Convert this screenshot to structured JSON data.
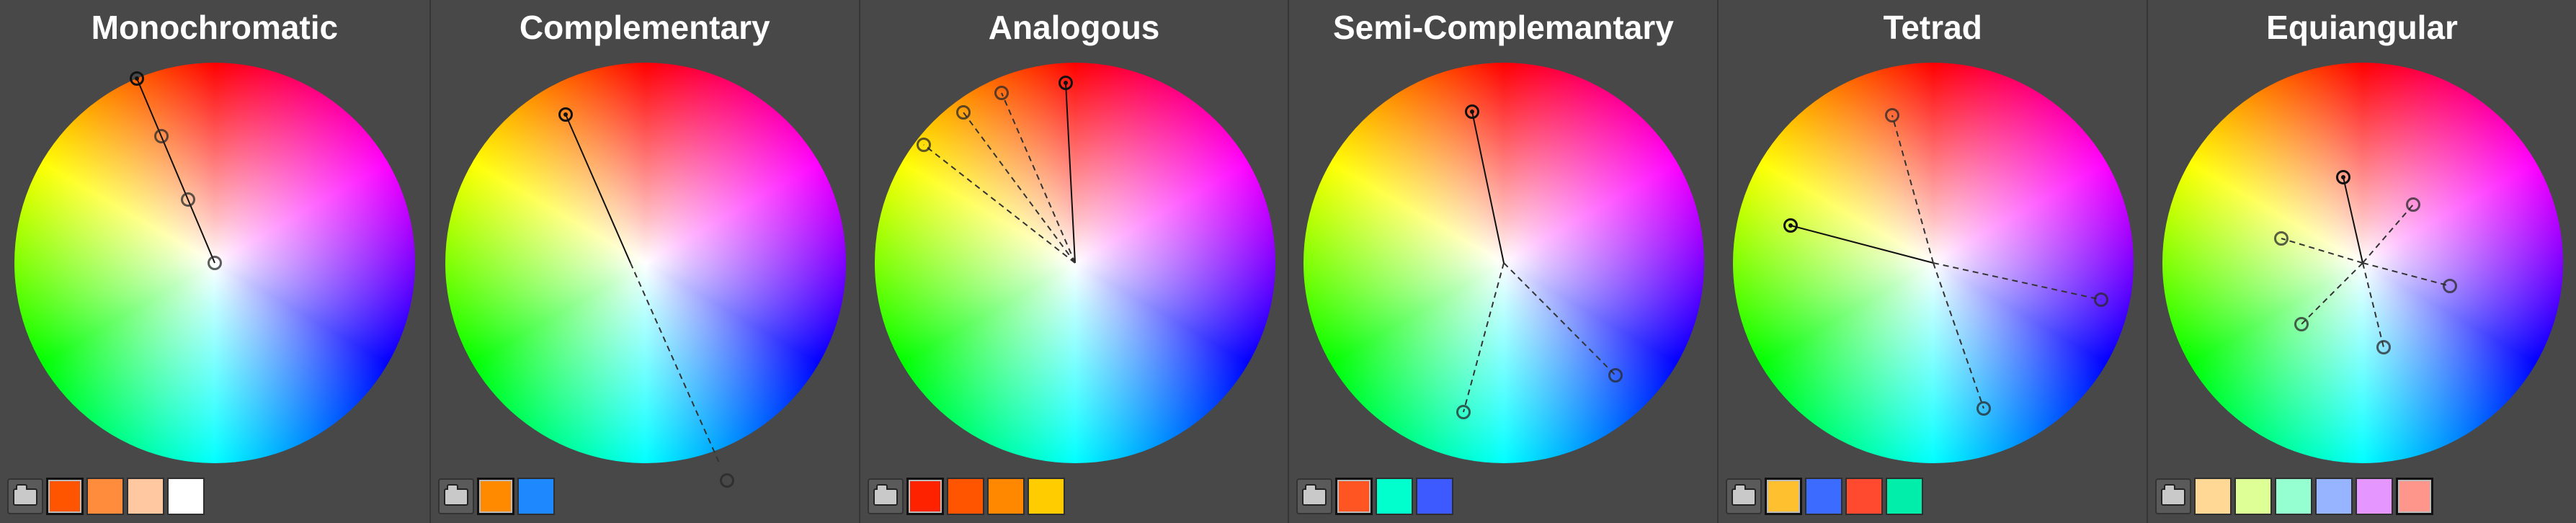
{
  "panels": [
    {
      "title": "Monochromatic",
      "center": [
        298,
        278
      ],
      "handles": [
        [
          190,
          22
        ],
        [
          224,
          102
        ],
        [
          261,
          190
        ],
        [
          298,
          278
        ]
      ],
      "primary_index": 0,
      "solid_lines": [
        [
          0,
          3
        ]
      ],
      "dashed_lines": [],
      "swatches": [
        "#ff5500",
        "#ff8c3c",
        "#ffc8a0",
        "#ffffff"
      ],
      "selected_swatch": 0
    },
    {
      "title": "Complementary",
      "center": [
        277,
        278
      ],
      "handles": [
        [
          187,
          72
        ],
        [
          411,
          580
        ]
      ],
      "primary_index": 0,
      "solid_lines": [
        [
          0,
          -1
        ]
      ],
      "dashed_lines": [
        [
          -1,
          1
        ]
      ],
      "swatches": [
        "#ff8a00",
        "#1e88ff"
      ],
      "selected_swatch": 0
    },
    {
      "title": "Analogous",
      "center": [
        298,
        278
      ],
      "handles": [
        [
          88,
          114
        ],
        [
          143,
          69
        ],
        [
          196,
          42
        ],
        [
          285,
          28
        ]
      ],
      "primary_index": 3,
      "solid_lines": [
        [
          -1,
          3
        ]
      ],
      "dashed_lines": [
        [
          -1,
          0
        ],
        [
          -1,
          1
        ],
        [
          -1,
          2
        ]
      ],
      "swatches": [
        "#ff2200",
        "#ff5500",
        "#ff8800",
        "#ffcc00"
      ],
      "selected_swatch": 0
    },
    {
      "title": "Semi-Complemantary",
      "center": [
        298,
        278
      ],
      "handles": [
        [
          254,
          68
        ],
        [
          242,
          485
        ],
        [
          453,
          434
        ]
      ],
      "primary_index": 0,
      "solid_lines": [
        [
          0,
          -1
        ]
      ],
      "dashed_lines": [
        [
          -1,
          1
        ],
        [
          -1,
          2
        ]
      ],
      "swatches": [
        "#ff5522",
        "#00ffcc",
        "#3c5aff"
      ],
      "selected_swatch": 0
    },
    {
      "title": "Tetrad",
      "center": [
        298,
        278
      ],
      "handles": [
        [
          100,
          226
        ],
        [
          241,
          73
        ],
        [
          531,
          329
        ],
        [
          368,
          480
        ]
      ],
      "primary_index": 0,
      "solid_lines": [
        [
          0,
          -1
        ]
      ],
      "dashed_lines": [
        [
          -1,
          1
        ],
        [
          -1,
          2
        ],
        [
          -1,
          3
        ]
      ],
      "swatches": [
        "#ffc030",
        "#3c6cff",
        "#ff4a30",
        "#00eeaa"
      ],
      "selected_swatch": 0
    },
    {
      "title": "Equiangular",
      "center": [
        298,
        278
      ],
      "handles": [
        [
          271,
          159
        ],
        [
          368,
          197
        ],
        [
          419,
          310
        ],
        [
          327,
          395
        ],
        [
          213,
          363
        ],
        [
          185,
          244
        ]
      ],
      "primary_index": 0,
      "solid_lines": [
        [
          0,
          -1
        ]
      ],
      "dashed_lines": [
        [
          -1,
          1
        ],
        [
          -1,
          2
        ],
        [
          -1,
          3
        ],
        [
          -1,
          4
        ],
        [
          -1,
          5
        ]
      ],
      "swatches": [
        "#ffd896",
        "#deff96",
        "#96ffd2",
        "#96b4ff",
        "#e696ff",
        "#ff968c"
      ],
      "selected_swatch": 5
    }
  ],
  "icons": {
    "palette_button": "folder-icon"
  }
}
